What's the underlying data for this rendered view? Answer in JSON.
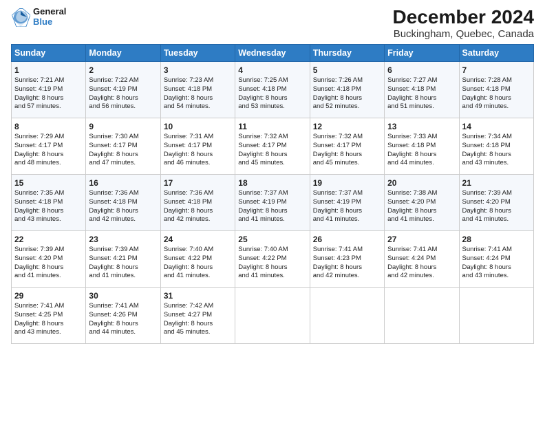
{
  "logo": {
    "line1": "General",
    "line2": "Blue"
  },
  "title": "December 2024",
  "subtitle": "Buckingham, Quebec, Canada",
  "days_header": [
    "Sunday",
    "Monday",
    "Tuesday",
    "Wednesday",
    "Thursday",
    "Friday",
    "Saturday"
  ],
  "weeks": [
    [
      {
        "day": "1",
        "lines": [
          "Sunrise: 7:21 AM",
          "Sunset: 4:19 PM",
          "Daylight: 8 hours",
          "and 57 minutes."
        ]
      },
      {
        "day": "2",
        "lines": [
          "Sunrise: 7:22 AM",
          "Sunset: 4:19 PM",
          "Daylight: 8 hours",
          "and 56 minutes."
        ]
      },
      {
        "day": "3",
        "lines": [
          "Sunrise: 7:23 AM",
          "Sunset: 4:18 PM",
          "Daylight: 8 hours",
          "and 54 minutes."
        ]
      },
      {
        "day": "4",
        "lines": [
          "Sunrise: 7:25 AM",
          "Sunset: 4:18 PM",
          "Daylight: 8 hours",
          "and 53 minutes."
        ]
      },
      {
        "day": "5",
        "lines": [
          "Sunrise: 7:26 AM",
          "Sunset: 4:18 PM",
          "Daylight: 8 hours",
          "and 52 minutes."
        ]
      },
      {
        "day": "6",
        "lines": [
          "Sunrise: 7:27 AM",
          "Sunset: 4:18 PM",
          "Daylight: 8 hours",
          "and 51 minutes."
        ]
      },
      {
        "day": "7",
        "lines": [
          "Sunrise: 7:28 AM",
          "Sunset: 4:18 PM",
          "Daylight: 8 hours",
          "and 49 minutes."
        ]
      }
    ],
    [
      {
        "day": "8",
        "lines": [
          "Sunrise: 7:29 AM",
          "Sunset: 4:17 PM",
          "Daylight: 8 hours",
          "and 48 minutes."
        ]
      },
      {
        "day": "9",
        "lines": [
          "Sunrise: 7:30 AM",
          "Sunset: 4:17 PM",
          "Daylight: 8 hours",
          "and 47 minutes."
        ]
      },
      {
        "day": "10",
        "lines": [
          "Sunrise: 7:31 AM",
          "Sunset: 4:17 PM",
          "Daylight: 8 hours",
          "and 46 minutes."
        ]
      },
      {
        "day": "11",
        "lines": [
          "Sunrise: 7:32 AM",
          "Sunset: 4:17 PM",
          "Daylight: 8 hours",
          "and 45 minutes."
        ]
      },
      {
        "day": "12",
        "lines": [
          "Sunrise: 7:32 AM",
          "Sunset: 4:17 PM",
          "Daylight: 8 hours",
          "and 45 minutes."
        ]
      },
      {
        "day": "13",
        "lines": [
          "Sunrise: 7:33 AM",
          "Sunset: 4:18 PM",
          "Daylight: 8 hours",
          "and 44 minutes."
        ]
      },
      {
        "day": "14",
        "lines": [
          "Sunrise: 7:34 AM",
          "Sunset: 4:18 PM",
          "Daylight: 8 hours",
          "and 43 minutes."
        ]
      }
    ],
    [
      {
        "day": "15",
        "lines": [
          "Sunrise: 7:35 AM",
          "Sunset: 4:18 PM",
          "Daylight: 8 hours",
          "and 43 minutes."
        ]
      },
      {
        "day": "16",
        "lines": [
          "Sunrise: 7:36 AM",
          "Sunset: 4:18 PM",
          "Daylight: 8 hours",
          "and 42 minutes."
        ]
      },
      {
        "day": "17",
        "lines": [
          "Sunrise: 7:36 AM",
          "Sunset: 4:18 PM",
          "Daylight: 8 hours",
          "and 42 minutes."
        ]
      },
      {
        "day": "18",
        "lines": [
          "Sunrise: 7:37 AM",
          "Sunset: 4:19 PM",
          "Daylight: 8 hours",
          "and 41 minutes."
        ]
      },
      {
        "day": "19",
        "lines": [
          "Sunrise: 7:37 AM",
          "Sunset: 4:19 PM",
          "Daylight: 8 hours",
          "and 41 minutes."
        ]
      },
      {
        "day": "20",
        "lines": [
          "Sunrise: 7:38 AM",
          "Sunset: 4:20 PM",
          "Daylight: 8 hours",
          "and 41 minutes."
        ]
      },
      {
        "day": "21",
        "lines": [
          "Sunrise: 7:39 AM",
          "Sunset: 4:20 PM",
          "Daylight: 8 hours",
          "and 41 minutes."
        ]
      }
    ],
    [
      {
        "day": "22",
        "lines": [
          "Sunrise: 7:39 AM",
          "Sunset: 4:20 PM",
          "Daylight: 8 hours",
          "and 41 minutes."
        ]
      },
      {
        "day": "23",
        "lines": [
          "Sunrise: 7:39 AM",
          "Sunset: 4:21 PM",
          "Daylight: 8 hours",
          "and 41 minutes."
        ]
      },
      {
        "day": "24",
        "lines": [
          "Sunrise: 7:40 AM",
          "Sunset: 4:22 PM",
          "Daylight: 8 hours",
          "and 41 minutes."
        ]
      },
      {
        "day": "25",
        "lines": [
          "Sunrise: 7:40 AM",
          "Sunset: 4:22 PM",
          "Daylight: 8 hours",
          "and 41 minutes."
        ]
      },
      {
        "day": "26",
        "lines": [
          "Sunrise: 7:41 AM",
          "Sunset: 4:23 PM",
          "Daylight: 8 hours",
          "and 42 minutes."
        ]
      },
      {
        "day": "27",
        "lines": [
          "Sunrise: 7:41 AM",
          "Sunset: 4:24 PM",
          "Daylight: 8 hours",
          "and 42 minutes."
        ]
      },
      {
        "day": "28",
        "lines": [
          "Sunrise: 7:41 AM",
          "Sunset: 4:24 PM",
          "Daylight: 8 hours",
          "and 43 minutes."
        ]
      }
    ],
    [
      {
        "day": "29",
        "lines": [
          "Sunrise: 7:41 AM",
          "Sunset: 4:25 PM",
          "Daylight: 8 hours",
          "and 43 minutes."
        ]
      },
      {
        "day": "30",
        "lines": [
          "Sunrise: 7:41 AM",
          "Sunset: 4:26 PM",
          "Daylight: 8 hours",
          "and 44 minutes."
        ]
      },
      {
        "day": "31",
        "lines": [
          "Sunrise: 7:42 AM",
          "Sunset: 4:27 PM",
          "Daylight: 8 hours",
          "and 45 minutes."
        ]
      },
      null,
      null,
      null,
      null
    ]
  ]
}
